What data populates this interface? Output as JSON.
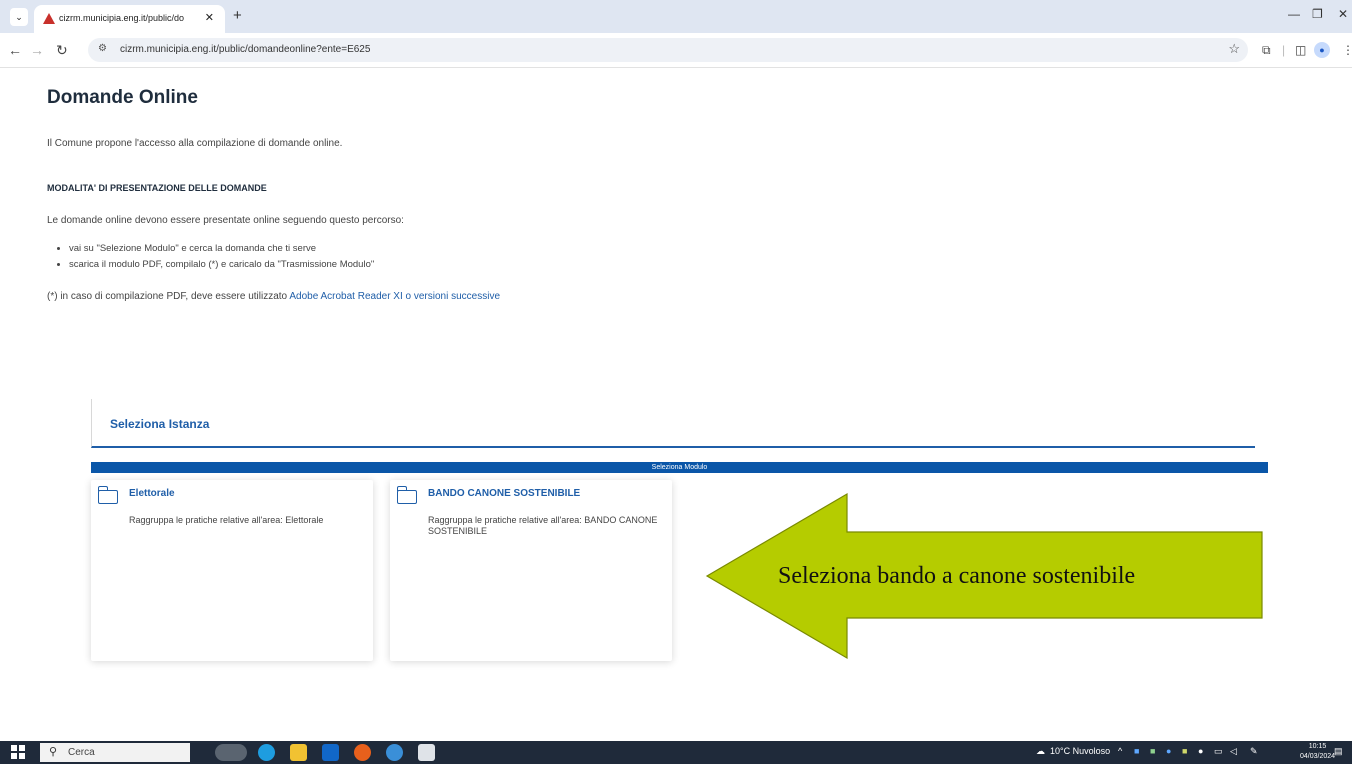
{
  "browser": {
    "tab_title": "cizrm.municipia.eng.it/public/do",
    "url": "cizrm.municipia.eng.it/public/domandeonline?ente=E625"
  },
  "page": {
    "heading": "Domande Online",
    "intro": "Il Comune propone l'accesso alla compilazione di domande online.",
    "modalita_title": "MODALITA' DI PRESENTAZIONE DELLE DOMANDE",
    "path_text": "Le domande online devono essere presentate online seguendo questo percorso:",
    "steps": [
      "vai su \"Selezione Modulo\" e cerca la domanda che ti serve",
      "scarica il modulo PDF, compilalo (*) e caricalo da \"Trasmissione Modulo\""
    ],
    "note_prefix": "(*) in caso di compilazione PDF, deve essere utilizzato ",
    "note_link": "Adobe Acrobat Reader XI o versioni successive",
    "istanza_label": "Seleziona Istanza",
    "modulo_bar": "Seleziona Modulo",
    "cards": [
      {
        "title": "Elettorale",
        "desc": "Raggruppa le pratiche relative all'area: Elettorale"
      },
      {
        "title": "BANDO CANONE SOSTENIBILE",
        "desc": "Raggruppa le pratiche relative all'area: BANDO CANONE SOSTENIBILE"
      }
    ],
    "callout": "Seleziona bando a canone sostenibile"
  },
  "taskbar": {
    "search_placeholder": "Cerca",
    "weather": "10°C  Nuvoloso",
    "time": "10:15",
    "date": "04/03/2024"
  },
  "colors": {
    "accent": "#1f5ea8",
    "modulo_bar": "#0a56a8",
    "callout_fill": "#b5cc00"
  }
}
